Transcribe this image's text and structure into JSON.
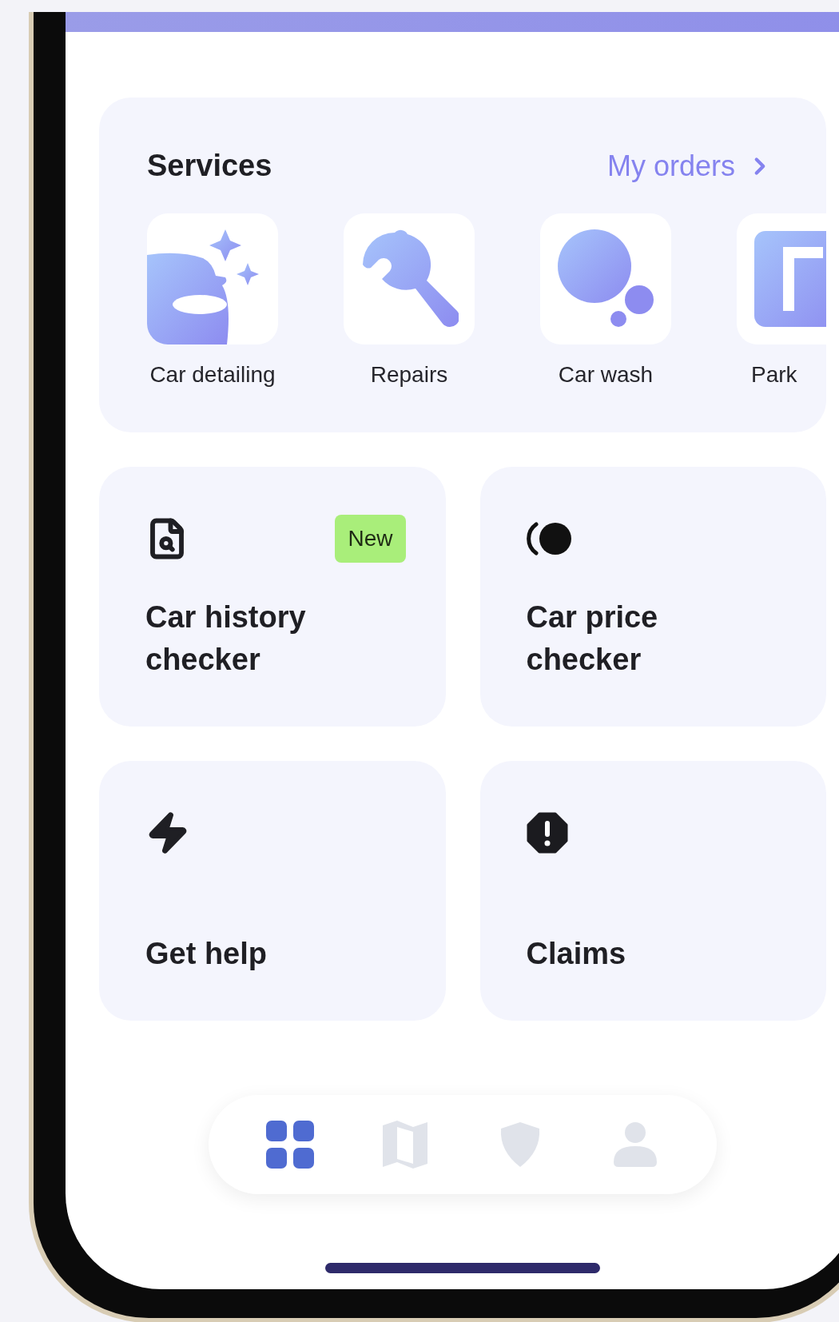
{
  "services": {
    "title": "Services",
    "link": "My orders",
    "items": [
      {
        "label": "Car detailing",
        "kind": "detailing"
      },
      {
        "label": "Repairs",
        "kind": "repairs"
      },
      {
        "label": "Car wash",
        "kind": "wash"
      },
      {
        "label": "Park",
        "kind": "parking"
      }
    ]
  },
  "cards": [
    {
      "title": "Car history checker",
      "kind": "history",
      "badge": "New"
    },
    {
      "title": "Car price checker",
      "kind": "price"
    },
    {
      "title": "Get help",
      "kind": "help"
    },
    {
      "title": "Claims",
      "kind": "claims"
    }
  ],
  "nav": [
    {
      "kind": "dashboard",
      "selected": true
    },
    {
      "kind": "map",
      "selected": false
    },
    {
      "kind": "shield",
      "selected": false
    },
    {
      "kind": "profile",
      "selected": false
    }
  ]
}
